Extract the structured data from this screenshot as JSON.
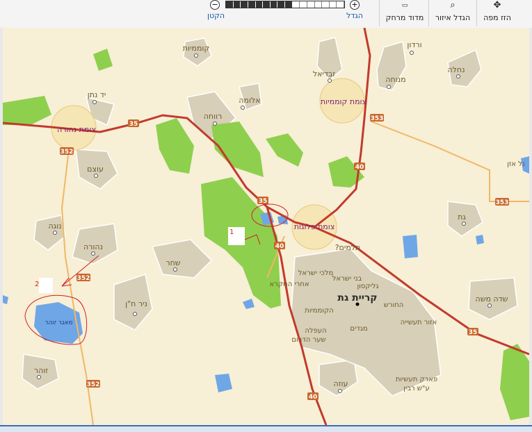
{
  "toolbar": {
    "pan_label": "הזז מפה",
    "zoom_area_label": "הגדל איזור",
    "measure_label": "מדוד מרחק",
    "zoom_in_label": "הגדל",
    "zoom_out_label": "הקטן",
    "zoom_level": 9,
    "zoom_steps": 16
  },
  "map": {
    "localities": [
      "קוממיות",
      "ורדון",
      "זבדיאל",
      "נחלה",
      "מנוחה",
      "יד נתן",
      "אלומה",
      "רווחה",
      "עוצם",
      "נוגה",
      "נהורה",
      "שחר",
      "ניר ח\"ן",
      "זוהר",
      "גת",
      "תלמים? ",
      "מלכי ישראל",
      "בני ישראל",
      "גליקסון",
      "אחרי המקרא",
      "קריית גת",
      "הקוממיות",
      "החורש",
      "אזור תעשייה",
      "מגדים",
      "העפלה",
      "שער הדרום",
      "עוזה",
      "פארק תעשיות",
      "ע\"ש רבין",
      "שדה משה",
      "נל אזן"
    ],
    "junctions": [
      "צומת קוממיות",
      "צומת נהורה",
      "צומת פלוגות"
    ],
    "route_numbers": [
      "35",
      "352",
      "353",
      "40"
    ],
    "water_label": "מאגר זוהר",
    "annotations": [
      "1",
      "2"
    ]
  }
}
